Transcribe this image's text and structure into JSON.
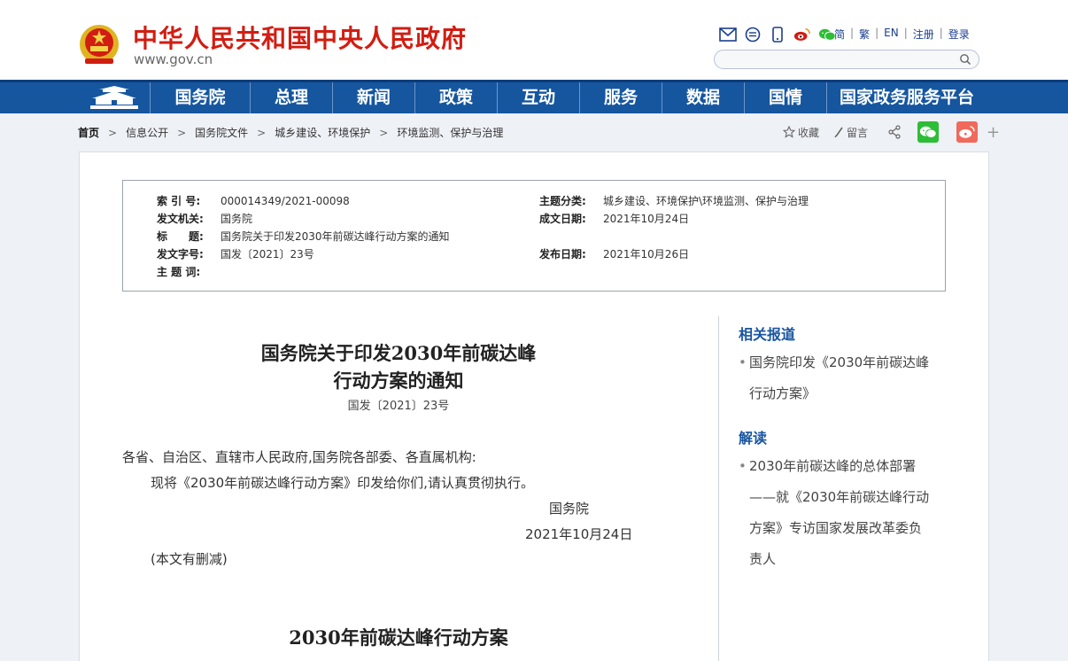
{
  "header": {
    "site_title": "中华人民共和国中央人民政府",
    "site_url": "www.gov.cn",
    "top_icons": [
      "mail-icon",
      "message-icon",
      "mobile-icon",
      "weibo-icon",
      "wechat-icon"
    ],
    "links": [
      "简",
      "繁",
      "EN",
      "注册",
      "登录"
    ],
    "search_placeholder": ""
  },
  "nav": {
    "items": [
      "国务院",
      "总理",
      "新闻",
      "政策",
      "互动",
      "服务",
      "数据",
      "国情",
      "国家政务服务平台"
    ]
  },
  "breadcrumb": {
    "items": [
      "首页",
      "信息公开",
      "国务院文件",
      "城乡建设、环境保护",
      "环境监测、保护与治理"
    ]
  },
  "tools": {
    "favorite": "收藏",
    "comment": "留言"
  },
  "meta": {
    "index_label": "索 引 号:",
    "index_value": "000014349/2021-00098",
    "topic_label": "主题分类:",
    "topic_value": "城乡建设、环境保护\\环境监测、保护与治理",
    "issuer_label": "发文机关:",
    "issuer_value": "国务院",
    "written_label": "成文日期:",
    "written_value": "2021年10月24日",
    "title_label": "标　　题:",
    "title_value": "国务院关于印发2030年前碳达峰行动方案的通知",
    "docnum_label": "发文字号:",
    "docnum_value": "国发〔2021〕23号",
    "published_label": "发布日期:",
    "published_value": "2021年10月26日",
    "keywords_label": "主 题 词:",
    "keywords_value": ""
  },
  "article": {
    "title_line1": "国务院关于印发2030年前碳达峰",
    "title_line2": "行动方案的通知",
    "doc_number": "国发〔2021〕23号",
    "salutation": "各省、自治区、直辖市人民政府,国务院各部委、各直属机构:",
    "body": "现将《2030年前碳达峰行动方案》印发给你们,请认真贯彻执行。",
    "signature": "国务院",
    "date": "2021年10月24日",
    "note": "(本文有删减)",
    "plan_title": "2030年前碳达峰行动方案"
  },
  "sidebar": {
    "related_heading": "相关报道",
    "related_items": [
      [
        "国务院印发《2030年前碳达峰",
        "行动方案》"
      ]
    ],
    "interpret_heading": "解读",
    "interpret_items": [
      [
        "2030年前碳达峰的总体部署",
        "——就《2030年前碳达峰行动",
        "方案》专访国家发展改革委负",
        "责人"
      ]
    ]
  },
  "colors": {
    "brand_red": "#d21d12",
    "nav_blue": "#15569f",
    "link_blue": "#1a56a0",
    "wechat_green": "#2ebd37",
    "weibo_red": "#f06a5b"
  }
}
